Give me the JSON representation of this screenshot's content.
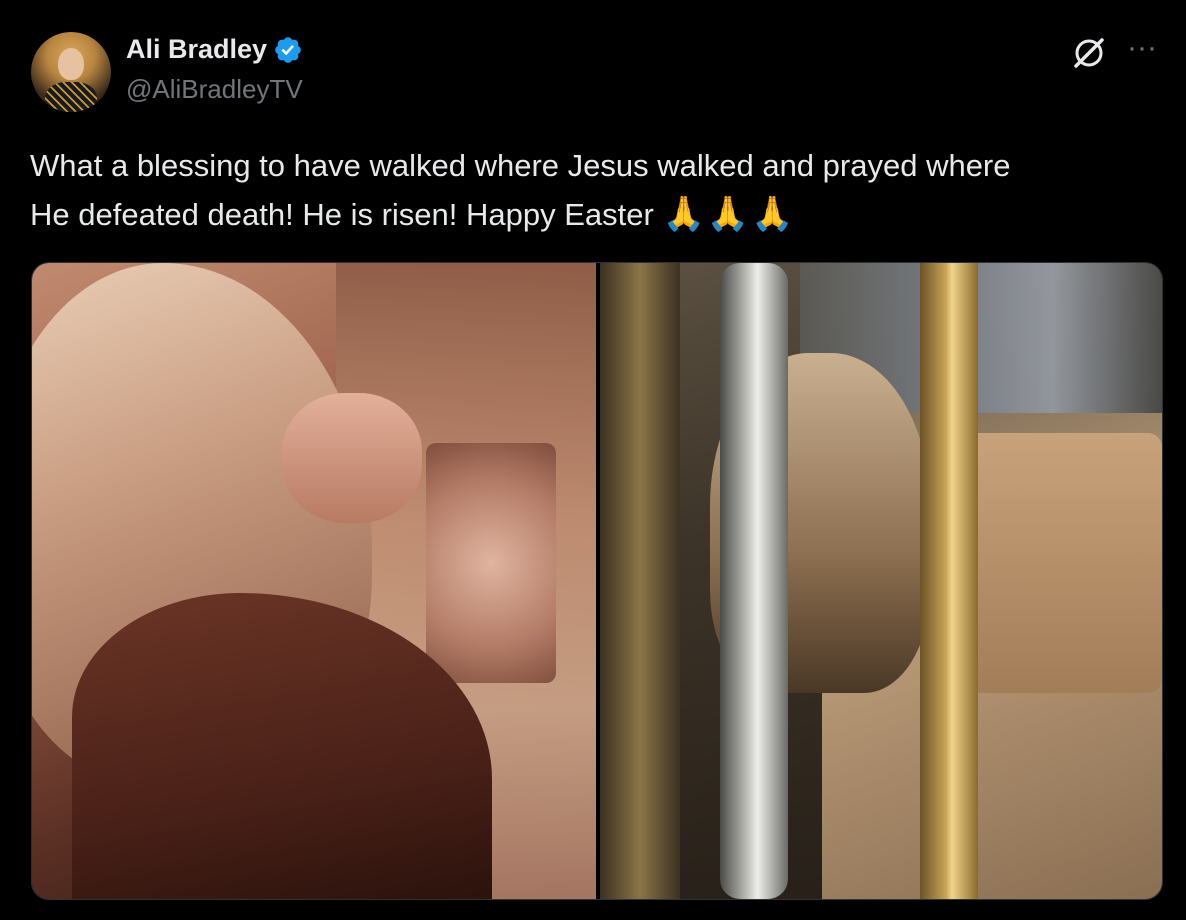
{
  "author": {
    "display_name": "Ali Bradley",
    "handle": "@AliBradleyTV",
    "verified": true,
    "verified_icon": "verified-badge-icon",
    "accent_color": "#1d9bf0"
  },
  "header_actions": {
    "grok_icon": "grok-icon",
    "more_icon": "more-options-icon",
    "more_label": "···"
  },
  "tweet": {
    "text_line1": "What a blessing to have walked where Jesus walked and prayed where",
    "text_line2": "He defeated death! He is risen! Happy Easter",
    "emoji": "🙏🙏🙏"
  },
  "media": {
    "count": 2
  },
  "colors": {
    "background": "#000000",
    "text": "#e7e9ea",
    "muted": "#71767b",
    "border": "#2f3336"
  }
}
